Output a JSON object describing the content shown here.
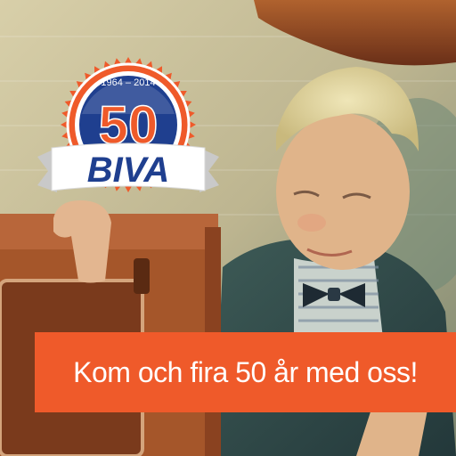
{
  "badge": {
    "years": "1964 – 2014",
    "number": "50",
    "brand": "BIVA",
    "colors": {
      "orange": "#ef5a2a",
      "navy": "#1f3f8f",
      "white": "#ffffff"
    }
  },
  "banner": {
    "text": "Kom och fira 50 år med oss!",
    "color": "#ef5a2a"
  }
}
